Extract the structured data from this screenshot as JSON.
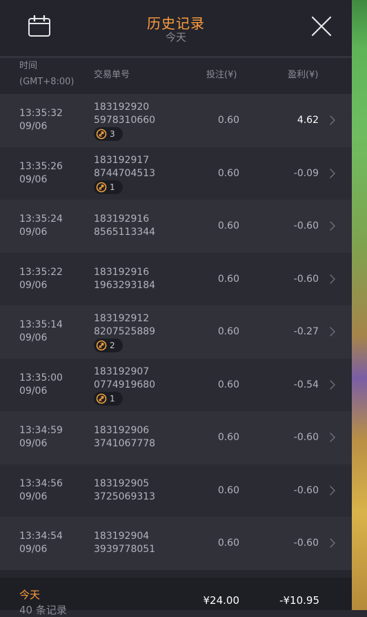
{
  "header": {
    "title": "历史记录",
    "subtitle": "今天",
    "calendar_icon": "calendar-icon",
    "close_icon": "close-icon"
  },
  "columns": {
    "time_line1": "时间",
    "time_line2": "(GMT+8:00)",
    "order_id": "交易单号",
    "bet": "投注(¥)",
    "profit": "盈利(¥)"
  },
  "rows": [
    {
      "time": "13:35:32",
      "date": "09/06",
      "id1": "183192920",
      "id2": "5978310660",
      "badge": "3",
      "bet": "0.60",
      "profit": "4.62",
      "positive": true
    },
    {
      "time": "13:35:26",
      "date": "09/06",
      "id1": "183192917",
      "id2": "8744704513",
      "badge": "1",
      "bet": "0.60",
      "profit": "-0.09",
      "positive": false
    },
    {
      "time": "13:35:24",
      "date": "09/06",
      "id1": "183192916",
      "id2": "8565113344",
      "badge": null,
      "bet": "0.60",
      "profit": "-0.60",
      "positive": false
    },
    {
      "time": "13:35:22",
      "date": "09/06",
      "id1": "183192916",
      "id2": "1963293184",
      "badge": null,
      "bet": "0.60",
      "profit": "-0.60",
      "positive": false
    },
    {
      "time": "13:35:14",
      "date": "09/06",
      "id1": "183192912",
      "id2": "8207525889",
      "badge": "2",
      "bet": "0.60",
      "profit": "-0.27",
      "positive": false
    },
    {
      "time": "13:35:00",
      "date": "09/06",
      "id1": "183192907",
      "id2": "0774919680",
      "badge": "1",
      "bet": "0.60",
      "profit": "-0.54",
      "positive": false
    },
    {
      "time": "13:34:59",
      "date": "09/06",
      "id1": "183192906",
      "id2": "3741067778",
      "badge": null,
      "bet": "0.60",
      "profit": "-0.60",
      "positive": false
    },
    {
      "time": "13:34:56",
      "date": "09/06",
      "id1": "183192905",
      "id2": "3725069313",
      "badge": null,
      "bet": "0.60",
      "profit": "-0.60",
      "positive": false
    },
    {
      "time": "13:34:54",
      "date": "09/06",
      "id1": "183192904",
      "id2": "3939778051",
      "badge": null,
      "bet": "0.60",
      "profit": "-0.60",
      "positive": false
    }
  ],
  "footer": {
    "label": "今天",
    "count": "40 条记录",
    "total_bet": "¥24.00",
    "total_profit": "-¥10.95"
  },
  "colors": {
    "accent": "#ff9d3d",
    "panel_bg": "#26262f",
    "row_odd": "#31313a",
    "row_even": "#2b2b34",
    "text_muted": "#8d8d97"
  }
}
